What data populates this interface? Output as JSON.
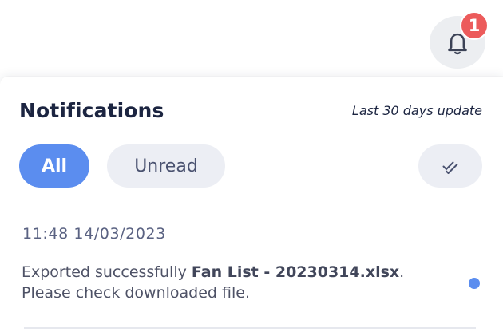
{
  "bell": {
    "icon": "bell-icon",
    "badge_count": "1"
  },
  "panel": {
    "title": "Notifications",
    "subtitle": "Last 30 days update",
    "tabs": [
      {
        "label": "All",
        "active": true
      },
      {
        "label": "Unread",
        "active": false
      }
    ],
    "mark_all_read_icon": "double-check-icon"
  },
  "notifications": [
    {
      "time": "11:48 14/03/2023",
      "message_prefix": "Exported successfully ",
      "file_name": "Fan List - 20230314.xlsx",
      "message_suffix": ".",
      "message_line2": "Please check downloaded file.",
      "unread": true
    }
  ],
  "colors": {
    "accent": "#5b8def",
    "badge": "#ec5b5b",
    "title": "#1c2541",
    "chip": "#eceef4"
  }
}
